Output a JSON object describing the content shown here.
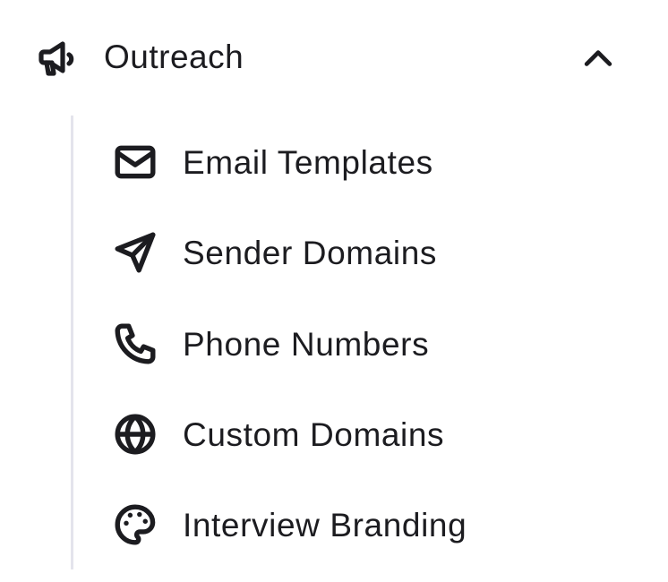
{
  "section": {
    "label": "Outreach",
    "icon": "megaphone-icon",
    "expanded": true
  },
  "items": [
    {
      "label": "Email Templates",
      "icon": "mail-icon"
    },
    {
      "label": "Sender Domains",
      "icon": "send-icon"
    },
    {
      "label": "Phone Numbers",
      "icon": "phone-icon"
    },
    {
      "label": "Custom Domains",
      "icon": "globe-icon"
    },
    {
      "label": "Interview Branding",
      "icon": "palette-icon"
    }
  ],
  "colors": {
    "text": "#1c1c20",
    "divider": "#e4e4ec",
    "background": "#ffffff"
  }
}
